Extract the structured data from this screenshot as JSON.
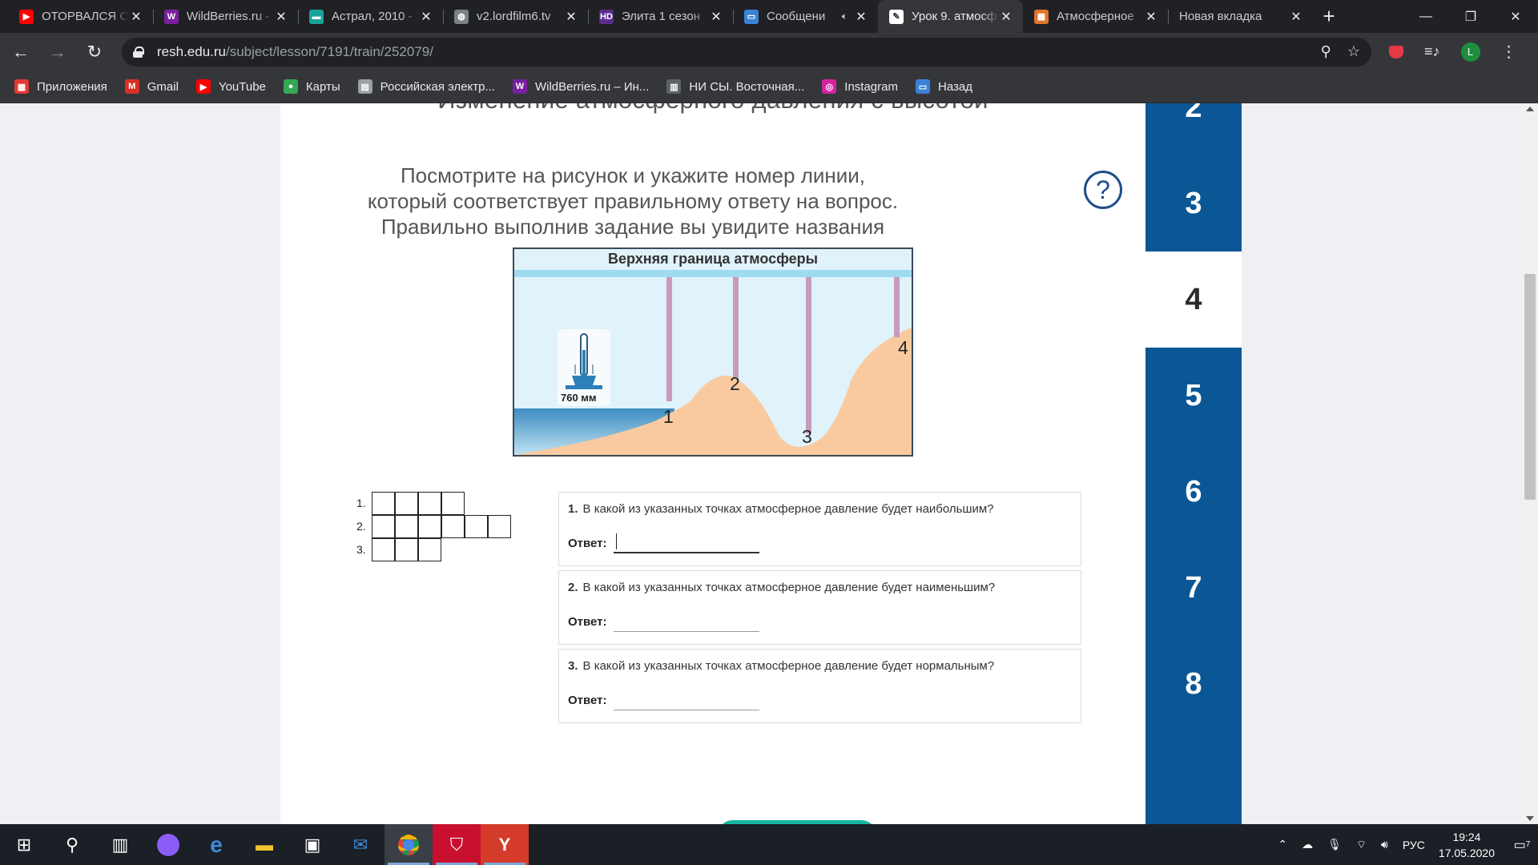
{
  "browser": {
    "tabs": [
      {
        "title": "ОТОРВАЛСЯ С",
        "icon": "youtube-icon",
        "color": "#ff0000",
        "glyph": "▶"
      },
      {
        "title": "WildBerries.ru -",
        "icon": "wildberries-icon",
        "color": "#7b1fa2",
        "glyph": "W"
      },
      {
        "title": "Астрал, 2010 -",
        "icon": "film-icon",
        "color": "#1aa39a",
        "glyph": "▬"
      },
      {
        "title": "v2.lordfilm6.tv",
        "icon": "globe-icon",
        "color": "#7c8087",
        "glyph": "◍"
      },
      {
        "title": "Элита 1 сезон",
        "icon": "hd-icon",
        "color": "#5b2c8e",
        "glyph": "HD"
      },
      {
        "title": "Сообщени",
        "icon": "message-icon",
        "color": "#3b82d6",
        "glyph": "▭",
        "audio": true
      },
      {
        "title": "Урок 9. атмосф",
        "icon": "lesson-icon",
        "color": "#e8eaed",
        "glyph": "✎",
        "active": true
      },
      {
        "title": "Атмосферное",
        "icon": "grid-icon",
        "color": "#e0742b",
        "glyph": "▦"
      },
      {
        "title": "Новая вкладка",
        "icon": "",
        "color": "",
        "glyph": ""
      }
    ],
    "new_tab_glyph": "+",
    "url_host": "resh.edu.ru",
    "url_path": "/subject/lesson/7191/train/252079/",
    "bookmarks": [
      {
        "label": "Приложения",
        "icon": "apps-grid-icon",
        "color": "#e53935",
        "glyph": "▦"
      },
      {
        "label": "Gmail",
        "icon": "gmail-icon",
        "color": "#d93025",
        "glyph": "M"
      },
      {
        "label": "YouTube",
        "icon": "youtube-icon",
        "color": "#ff0000",
        "glyph": "▶"
      },
      {
        "label": "Карты",
        "icon": "maps-pin-icon",
        "color": "#34a853",
        "glyph": "●"
      },
      {
        "label": "Российская электр...",
        "icon": "document-icon",
        "color": "#9aa0a6",
        "glyph": "▤"
      },
      {
        "label": "WildBerries.ru – Ин...",
        "icon": "wildberries-icon",
        "color": "#7b1fa2",
        "glyph": "W"
      },
      {
        "label": "НИ СЫ. Восточная...",
        "icon": "book-icon",
        "color": "#5f6368",
        "glyph": "▥"
      },
      {
        "label": "Instagram",
        "icon": "instagram-icon",
        "color": "#d6249f",
        "glyph": "◎"
      },
      {
        "label": "Назад",
        "icon": "message-icon",
        "color": "#3b82d6",
        "glyph": "▭"
      }
    ],
    "profile_initial": "L"
  },
  "lesson": {
    "title": "Изменение атмосферного давления с высотой",
    "instruction": "Посмотрите на рисунок и укажите номер линии, который соответствует правильному ответу на вопрос. Правильно выполнив задание вы увидите названия различных ветров.",
    "help_glyph": "?",
    "figure": {
      "top_label": "Верхняя граница атмосферы",
      "barometer_label": "760 мм",
      "point_labels": [
        "1",
        "2",
        "3",
        "4"
      ]
    },
    "crossword_rows": [
      {
        "num": "1.",
        "cells": 4
      },
      {
        "num": "2.",
        "cells": 6
      },
      {
        "num": "3.",
        "cells": 3
      }
    ],
    "questions": [
      {
        "num": "1.",
        "text": "В какой из указанных точках атмосферное давление будет наибольшим?",
        "answer_label": "Ответ:",
        "value": ""
      },
      {
        "num": "2.",
        "text": "В какой из указанных точках атмосферное давление будет наименьшим?",
        "answer_label": "Ответ:",
        "value": ""
      },
      {
        "num": "3.",
        "text": "В какой из указанных точках атмосферное давление будет нормальным?",
        "answer_label": "Ответ:",
        "value": ""
      }
    ]
  },
  "sidebar": {
    "items": [
      "2",
      "3",
      "4",
      "5",
      "6",
      "7",
      "8"
    ],
    "active_item": "4",
    "color": "#0b5796"
  },
  "taskbar": {
    "language": "РУС",
    "time": "19:24",
    "date": "17.05.2020",
    "notifications": "7"
  }
}
